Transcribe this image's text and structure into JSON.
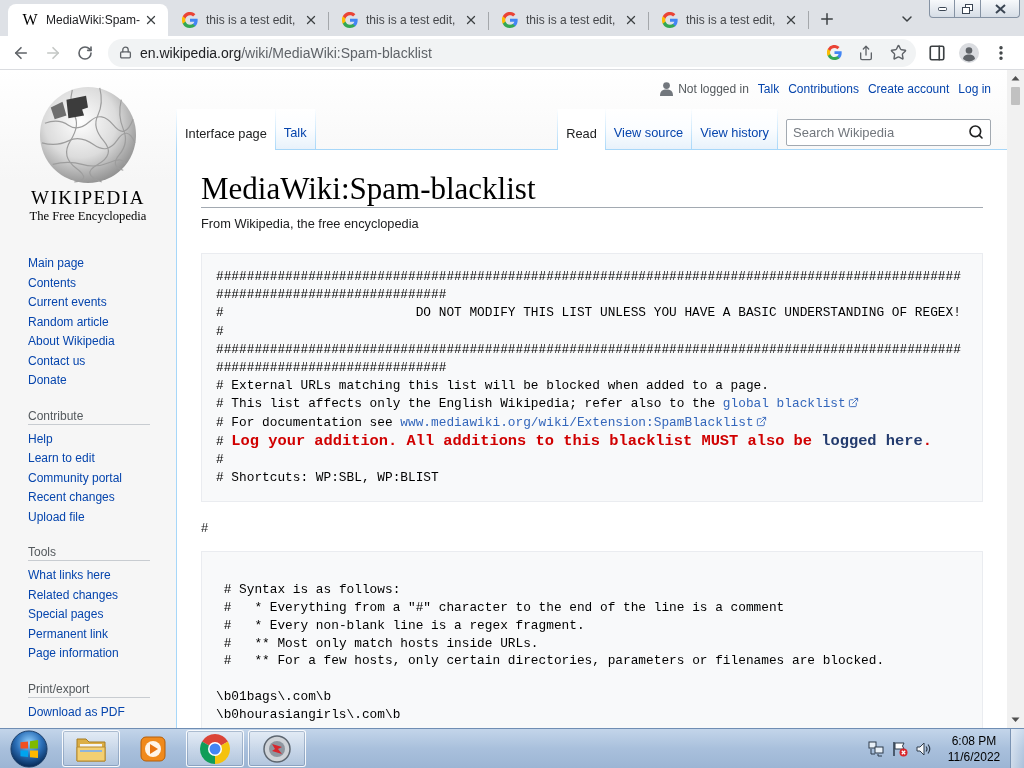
{
  "browser": {
    "tabs": [
      {
        "title": "MediaWiki:Spam-",
        "favicon": {
          "kind": "letter",
          "text": "W"
        },
        "selected": true
      },
      {
        "title": "this is a test edit,",
        "favicon": {
          "kind": "g_logo"
        },
        "selected": false
      },
      {
        "title": "this is a test edit,",
        "favicon": {
          "kind": "g_logo"
        },
        "selected": false
      },
      {
        "title": "this is a test edit,",
        "favicon": {
          "kind": "g_logo"
        },
        "selected": false
      },
      {
        "title": "this is a test edit,",
        "favicon": {
          "kind": "g_logo"
        },
        "selected": false
      }
    ],
    "nav_buttons": [
      {
        "kind": "back",
        "disabled": false
      },
      {
        "kind": "forward",
        "disabled": true
      },
      {
        "kind": "reload",
        "disabled": false
      }
    ],
    "address_bar": {
      "host": "en.wikipedia.org",
      "path": "/wiki/MediaWiki:Spam-blacklist"
    }
  },
  "wiki": {
    "logo": {
      "wordmark": "WIKIPEDIA",
      "tagline": "The Free Encyclopedia"
    },
    "navigation": [
      "Main page",
      "Contents",
      "Current events",
      "Random article",
      "About Wikipedia",
      "Contact us",
      "Donate"
    ],
    "portals": [
      {
        "heading": "Contribute",
        "items": [
          "Help",
          "Learn to edit",
          "Community portal",
          "Recent changes",
          "Upload file"
        ]
      },
      {
        "heading": "Tools",
        "items": [
          "What links here",
          "Related changes",
          "Special pages",
          "Permanent link",
          "Page information"
        ]
      },
      {
        "heading": "Print/export",
        "items": [
          "Download as PDF"
        ]
      }
    ],
    "personal_tools": {
      "status": "Not logged in",
      "links": [
        "Talk",
        "Contributions",
        "Create account",
        "Log in"
      ]
    },
    "namespace_tabs": [
      {
        "label": "Interface page",
        "selected": true
      },
      {
        "label": "Talk",
        "selected": false
      }
    ],
    "view_tabs": [
      {
        "label": "Read",
        "selected": true
      },
      {
        "label": "View source",
        "selected": false
      },
      {
        "label": "View history",
        "selected": false
      }
    ],
    "search": {
      "placeholder": "Search Wikipedia"
    },
    "title": "MediaWiki:Spam-blacklist",
    "subtitle": "From Wikipedia, the free encyclopedia",
    "blocks": [
      {
        "kind": "code",
        "lines": [
          {
            "kind": "text",
            "text": "###############################################################################################################################"
          },
          {
            "kind": "text",
            "text": "#                         DO NOT MODIFY THIS LIST UNLESS YOU HAVE A BASIC UNDERSTANDING OF REGEX!"
          },
          {
            "kind": "text",
            "text": "#"
          },
          {
            "kind": "text",
            "text": "###############################################################################################################################"
          },
          {
            "kind": "text",
            "text": "# External URLs matching this list will be blocked when added to a page."
          },
          {
            "kind": "rich",
            "segments": [
              {
                "kind": "plain",
                "text": "# This list affects only the English Wikipedia; refer also to the "
              },
              {
                "kind": "link",
                "text": "global blacklist",
                "external": true
              }
            ]
          },
          {
            "kind": "rich",
            "segments": [
              {
                "kind": "plain",
                "text": "# For documentation see "
              },
              {
                "kind": "link",
                "text": "www.mediawiki.org/wiki/Extension:SpamBlacklist",
                "external": true
              }
            ]
          },
          {
            "kind": "rich",
            "segments": [
              {
                "kind": "plain",
                "text": "# "
              },
              {
                "kind": "alert",
                "text": "Log your addition. All additions to this blacklist MUST also be "
              },
              {
                "kind": "alert_link",
                "text": "logged here"
              },
              {
                "kind": "alert",
                "text": "."
              }
            ]
          },
          {
            "kind": "text",
            "text": "#"
          },
          {
            "kind": "text",
            "text": "# Shortcuts: WP:SBL, WP:BLIST"
          }
        ]
      },
      {
        "kind": "paragraph",
        "text": "#"
      },
      {
        "kind": "code",
        "lines": [
          {
            "kind": "blank"
          },
          {
            "kind": "text",
            "text": " # Syntax is as follows:"
          },
          {
            "kind": "text",
            "text": " #   * Everything from a \"#\" character to the end of the line is a comment"
          },
          {
            "kind": "text",
            "text": " #   * Every non-blank line is a regex fragment."
          },
          {
            "kind": "text",
            "text": " #   ** Most only match hosts inside URLs."
          },
          {
            "kind": "text",
            "text": " #   ** For a few hosts, only certain directories, parameters or filenames are blocked."
          },
          {
            "kind": "blank"
          },
          {
            "kind": "text",
            "text": "\\b01bags\\.com\\b"
          },
          {
            "kind": "text",
            "text": "\\b0hourasiangirls\\.com\\b"
          }
        ]
      }
    ]
  },
  "taskbar": {
    "apps": [
      {
        "kind": "folder",
        "running": true
      },
      {
        "kind": "media",
        "running": false
      },
      {
        "kind": "browser",
        "running": true
      },
      {
        "kind": "disc",
        "running": true
      }
    ],
    "clock": {
      "time": "6:08 PM",
      "date": "11/6/2022"
    }
  }
}
